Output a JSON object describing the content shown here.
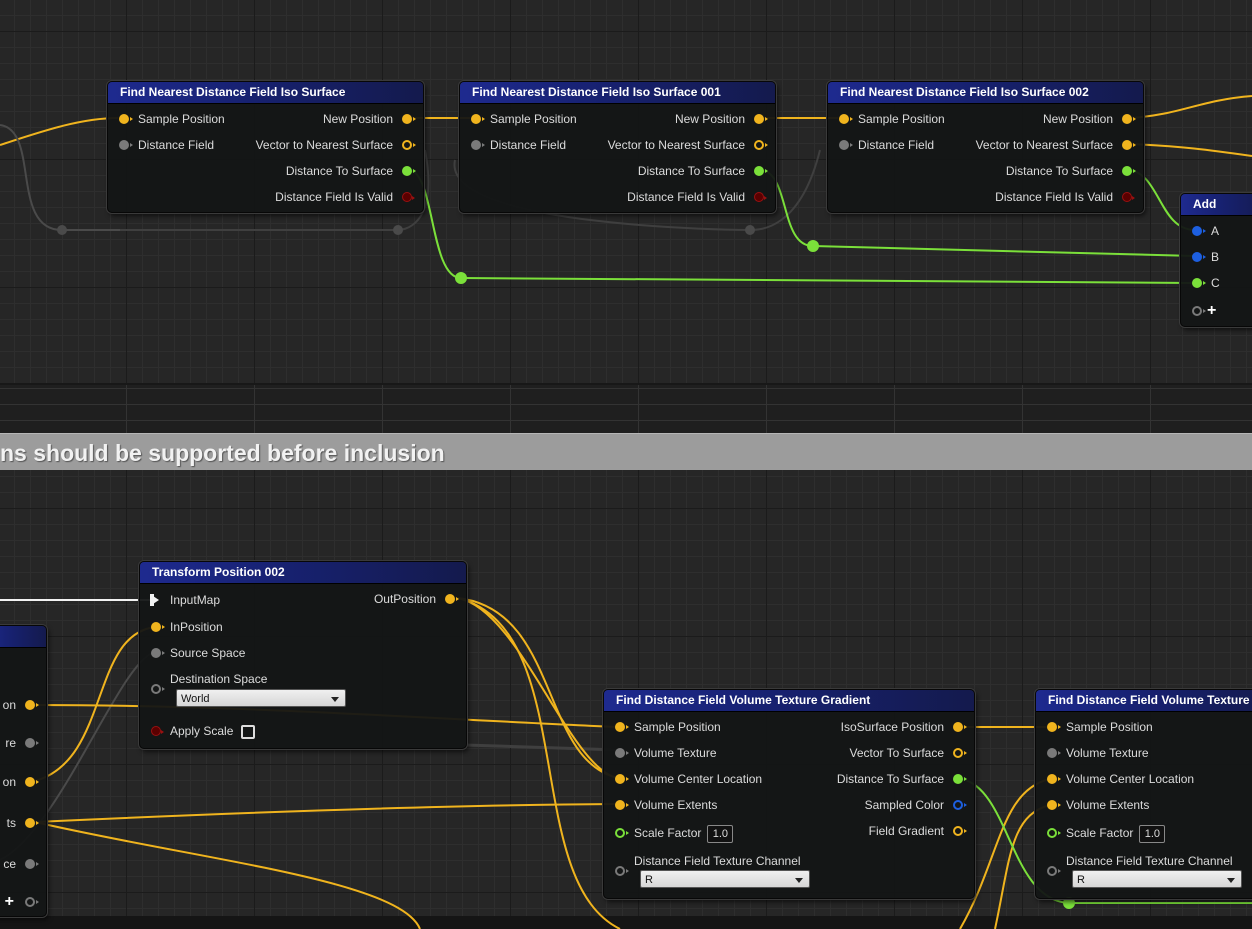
{
  "comment": {
    "text": "ns should be supported before inclusion"
  },
  "colors": {
    "node_header": "#1e2a8f",
    "wire_position": "#f0b41e",
    "wire_float": "#7be03a",
    "wire_distance_field": "#7a7a7a",
    "wire_exec": "#f2f2f2",
    "comment_bar": "#9c9c9c"
  },
  "nodes": {
    "find_iso_1": {
      "title": "Find Nearest Distance Field Iso Surface",
      "in_sample_position": "Sample Position",
      "in_distance_field": "Distance Field",
      "out_new_position": "New Position",
      "out_vector_to_surface": "Vector to Nearest Surface",
      "out_distance_to_surface": "Distance To Surface",
      "out_is_valid": "Distance Field Is Valid"
    },
    "find_iso_2": {
      "title": "Find Nearest Distance Field Iso Surface 001",
      "in_sample_position": "Sample Position",
      "in_distance_field": "Distance Field",
      "out_new_position": "New Position",
      "out_vector_to_surface": "Vector to Nearest Surface",
      "out_distance_to_surface": "Distance To Surface",
      "out_is_valid": "Distance Field Is Valid"
    },
    "find_iso_3": {
      "title": "Find Nearest Distance Field Iso Surface 002",
      "in_sample_position": "Sample Position",
      "in_distance_field": "Distance Field",
      "out_new_position": "New Position",
      "out_vector_to_surface": "Vector to Nearest Surface",
      "out_distance_to_surface": "Distance To Surface",
      "out_is_valid": "Distance Field Is Valid"
    },
    "add": {
      "title": "Add",
      "pin_a": "A",
      "pin_b": "B",
      "pin_c": "C",
      "add_pin_icon": "plus-icon"
    },
    "transform": {
      "title": "Transform Position 002",
      "in_input_map": "InputMap",
      "in_position": "InPosition",
      "in_source_space": "Source Space",
      "in_destination_space": "Destination Space",
      "destination_space_value": "World",
      "in_apply_scale": "Apply Scale",
      "apply_scale_checked": false,
      "out_position": "OutPosition"
    },
    "left_partial": {
      "pin_labels": [
        "on",
        "re",
        "on",
        "ts",
        "ce"
      ]
    },
    "gradient_1": {
      "title": "Find Distance Field Volume Texture Gradient",
      "in_sample_position": "Sample Position",
      "in_volume_texture": "Volume Texture",
      "in_volume_center": "Volume Center Location",
      "in_volume_extents": "Volume Extents",
      "in_scale_factor": "Scale Factor",
      "scale_factor_value": "1.0",
      "in_texture_channel": "Distance Field Texture Channel",
      "texture_channel_value": "R",
      "out_iso_position": "IsoSurface Position",
      "out_vector_to_surface": "Vector To Surface",
      "out_distance_to_surface": "Distance To Surface",
      "out_sampled_color": "Sampled Color",
      "out_field_gradient": "Field Gradient"
    },
    "gradient_2": {
      "title": "Find Distance Field Volume Texture",
      "in_sample_position": "Sample Position",
      "in_volume_texture": "Volume Texture",
      "in_volume_center": "Volume Center Location",
      "in_volume_extents": "Volume Extents",
      "in_scale_factor": "Scale Factor",
      "scale_factor_value": "1.0",
      "in_texture_channel": "Distance Field Texture Channel",
      "texture_channel_value": "R"
    }
  }
}
